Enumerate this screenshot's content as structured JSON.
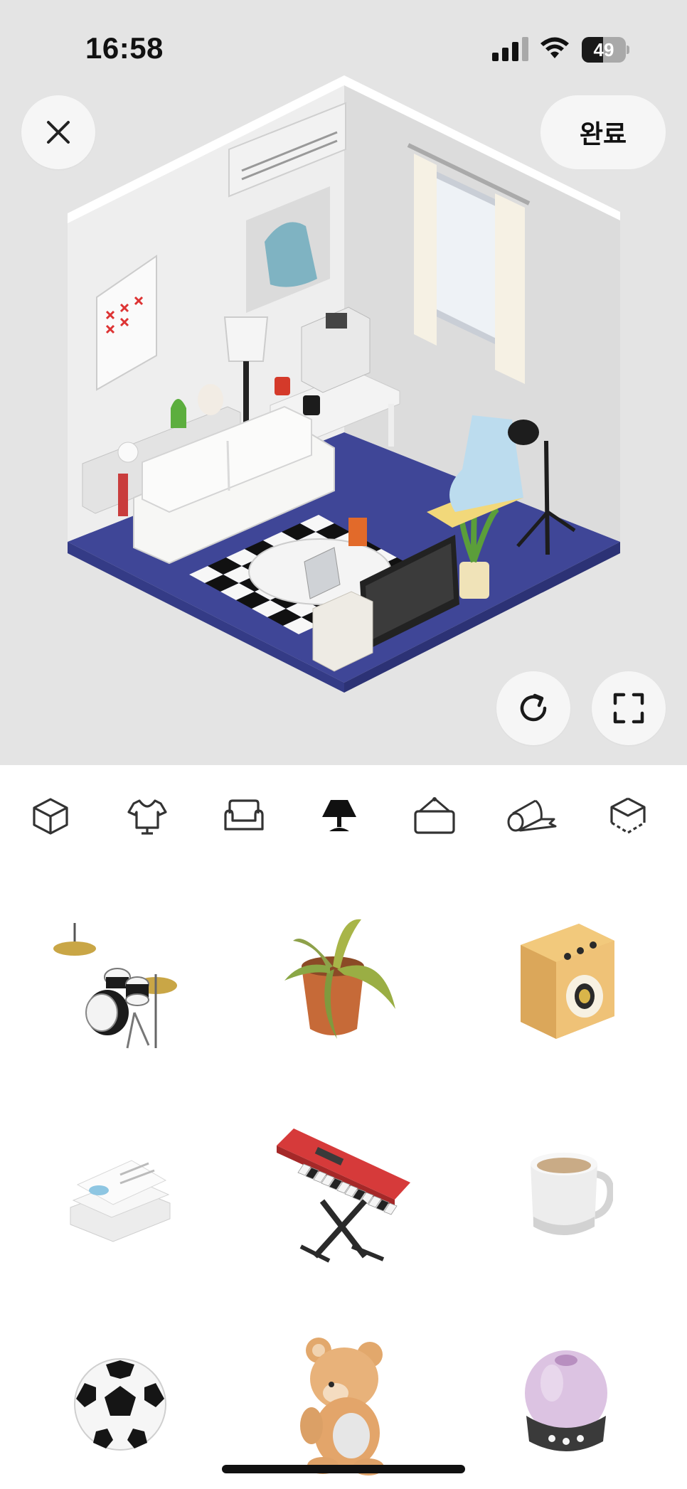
{
  "status_bar": {
    "time": "16:58",
    "battery_level": "49",
    "battery_fraction": 0.49
  },
  "header": {
    "close_icon": "close-icon",
    "done_label": "완료"
  },
  "scene_controls": {
    "rotate_icon": "rotate-icon",
    "expand_icon": "fullscreen-icon"
  },
  "categories": [
    {
      "icon": "room-cube-icon",
      "selected": false
    },
    {
      "icon": "clothing-hanger-icon",
      "selected": false
    },
    {
      "icon": "sofa-icon",
      "selected": false
    },
    {
      "icon": "lamp-icon",
      "selected": true
    },
    {
      "icon": "wall-frame-icon",
      "selected": false
    },
    {
      "icon": "floor-roll-icon",
      "selected": false
    },
    {
      "icon": "room-shape-icon",
      "selected": false
    }
  ],
  "items": [
    {
      "icon": "drum-kit-icon"
    },
    {
      "icon": "potted-plant-icon"
    },
    {
      "icon": "speaker-amp-icon"
    },
    {
      "icon": "paper-stack-icon"
    },
    {
      "icon": "keyboard-piano-icon"
    },
    {
      "icon": "coffee-mug-icon"
    },
    {
      "icon": "soccer-ball-icon"
    },
    {
      "icon": "teddy-bear-icon"
    },
    {
      "icon": "humidifier-icon"
    }
  ],
  "colors": {
    "scene_bg": "#e4e4e4",
    "floor_blue": "#3f4697",
    "accent_black": "#111111"
  }
}
